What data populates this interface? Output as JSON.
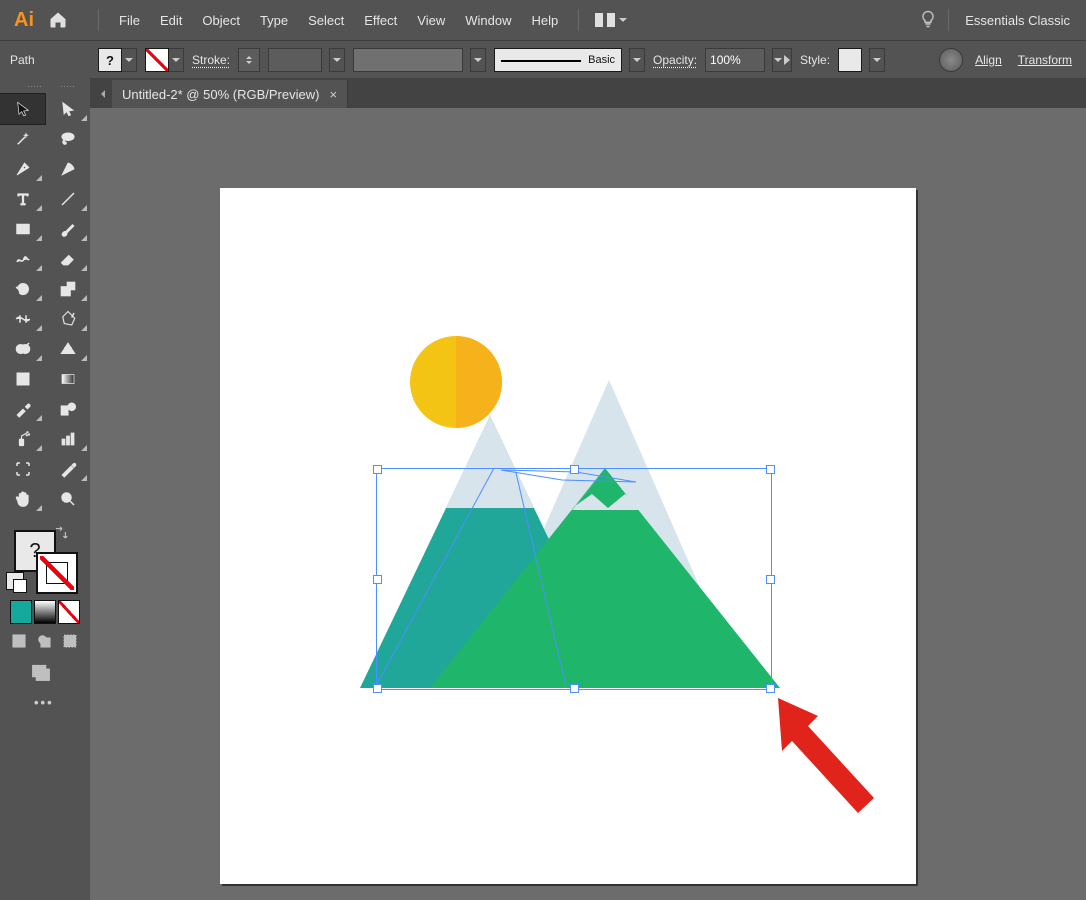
{
  "menu": {
    "items": [
      "File",
      "Edit",
      "Object",
      "Type",
      "Select",
      "Effect",
      "View",
      "Window",
      "Help"
    ],
    "workspace": "Essentials Classic"
  },
  "control_bar": {
    "selection_label": "Path",
    "fill_value": "?",
    "stroke_label": "Stroke:",
    "stroke_weight": "",
    "varwidth_value": "",
    "brush_label": "Basic",
    "opacity_label": "Opacity:",
    "opacity_value": "100%",
    "style_label": "Style:",
    "align_link": "Align",
    "transform_link": "Transform"
  },
  "tab": {
    "title": "Untitled-2* @ 50% (RGB/Preview)",
    "close": "×"
  },
  "toolbar": {
    "fill_char": "?",
    "fill_color": "#e9e9e9",
    "stroke_color": "none",
    "more": "•••"
  }
}
